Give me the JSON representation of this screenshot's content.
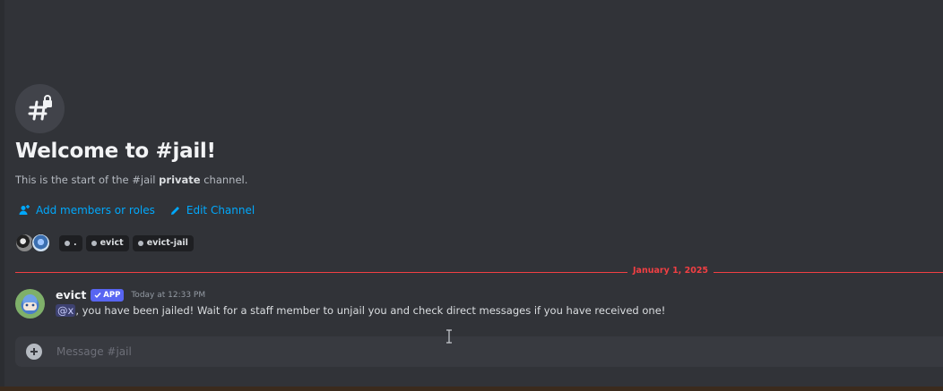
{
  "channel": {
    "icon": "hash-lock-icon",
    "welcome_title": "Welcome to #jail!",
    "intro_prefix": "This is the start of the #jail ",
    "intro_bold": "private",
    "intro_suffix": " channel."
  },
  "actions": [
    {
      "label": "Add members or roles",
      "icon": "add-member-icon"
    },
    {
      "label": "Edit Channel",
      "icon": "pencil-icon"
    }
  ],
  "roles": [
    ".",
    "evict",
    "evict-jail"
  ],
  "divider": {
    "date": "January 1, 2025"
  },
  "message": {
    "author": "evict",
    "badge": "APP",
    "timestamp": "Today at 12:33 PM",
    "mention": "@x",
    "text": ", you have been jailed! Wait for a staff member to unjail you and check direct messages if you have received one!"
  },
  "composer": {
    "placeholder": "Message #jail"
  },
  "colors": {
    "background": "#313338",
    "link": "#00a8fc",
    "divider": "#f23f43",
    "badge": "#5865f2"
  }
}
